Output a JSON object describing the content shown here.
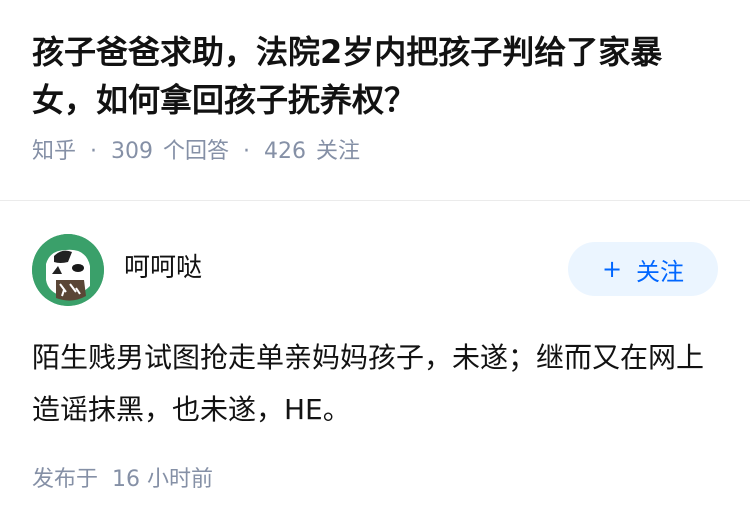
{
  "question": {
    "title": "孩子爸爸求助，法院2岁内把孩子判给了家暴女，如何拿回孩子抚养权？",
    "source": "知乎",
    "separator": "·",
    "answer_count": "309",
    "answer_label": "个回答",
    "follower_count": "426",
    "follower_label": "关注"
  },
  "answer": {
    "author_name": "呵呵哒",
    "avatar_icon": "cartoon-avatar-icon",
    "follow_plus": "+",
    "follow_label": "关注",
    "content": "陌生贱男试图抢走单亲妈妈孩子，未遂；继而又在网上造谣抹黑，也未遂，HE。",
    "published_prefix": "发布于",
    "published_time": "16 小时前"
  },
  "colors": {
    "title": "#121212",
    "meta": "#8590a6",
    "accent": "#0066ff",
    "follow_bg": "#ebf5ff",
    "avatar_bg": "#3aa06a"
  }
}
